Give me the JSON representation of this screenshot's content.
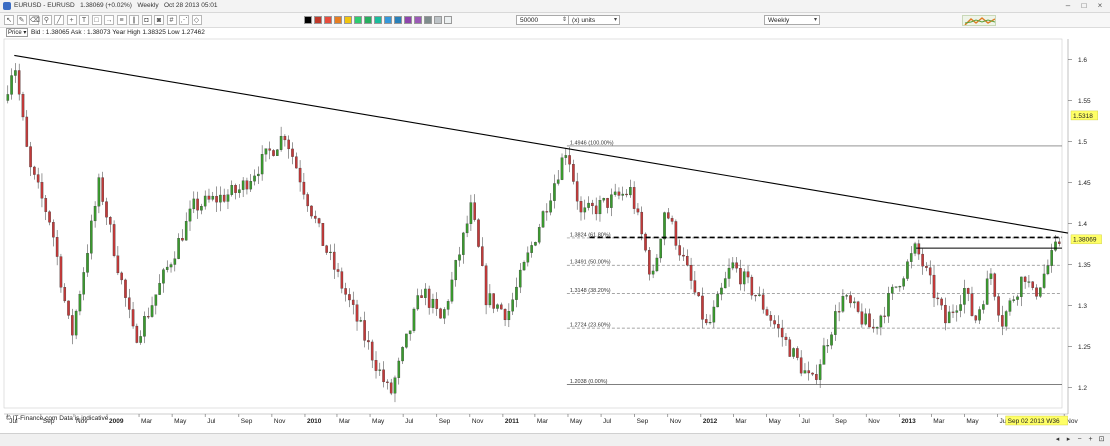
{
  "window": {
    "title": "EURUSD - EURUSD",
    "price_change": "1.38069 (+0.02%)",
    "timeframe": "Weekly",
    "datetime": "Oct 28 2013 05:01"
  },
  "toolbar": {
    "icons": [
      "cursor-icon",
      "pencil-icon",
      "eraser-icon",
      "zoom-icon",
      "line-icon",
      "crosshair-icon",
      "text-icon",
      "shape-icon",
      "arrow-icon",
      "fib-icon",
      "channel-icon",
      "lock-icon",
      "camera-icon",
      "grid-icon",
      "fan-icon",
      "pattern-icon"
    ],
    "swatch_colors": [
      "#000000",
      "#c0392b",
      "#e74c3c",
      "#e67e22",
      "#f1c40f",
      "#2ecc71",
      "#27ae60",
      "#1abc9c",
      "#3498db",
      "#2980b9",
      "#8e44ad",
      "#9b59b6",
      "#7f8c8d",
      "#bdc3c7",
      "#ecf0f1"
    ],
    "quantity_value": "50000",
    "units_value": "(x) units",
    "period_value": "Weekly"
  },
  "info": {
    "price_box": "Price",
    "bid": "Bid : 1.38065",
    "ask": "Ask : 1.38073",
    "year_high": "Year High 1.38325",
    "low": "Low 1.27462"
  },
  "footer": {
    "text": "© IT-Finance.com Data is indicative",
    "tools": [
      "scroll-left-icon",
      "scroll-right-icon",
      "zoom-out-icon",
      "zoom-in-icon",
      "zoom-fit-icon"
    ]
  },
  "chart_data": {
    "type": "candlestick",
    "symbol": "EURUSD",
    "period": "Weekly",
    "y_axis": {
      "min": 1.175,
      "max": 1.625,
      "ticks": [
        1.2,
        1.25,
        1.3,
        1.35,
        1.4,
        1.45,
        1.5,
        1.55,
        1.6
      ],
      "tick_labels": [
        "1.2",
        "1.25",
        "1.3",
        "1.35",
        "1.4",
        "1.45",
        "1.5",
        "1.55",
        "1.6"
      ]
    },
    "x_axis": {
      "start": "2008-06-25",
      "end": "2013-10-28",
      "labels": [
        {
          "date": "2008-07-01",
          "label": "Jul"
        },
        {
          "date": "2008-09-01",
          "label": "Sep"
        },
        {
          "date": "2008-11-01",
          "label": "Nov"
        },
        {
          "date": "2009-01-01",
          "label": "2009"
        },
        {
          "date": "2009-03-01",
          "label": "Mar"
        },
        {
          "date": "2009-05-01",
          "label": "May"
        },
        {
          "date": "2009-07-01",
          "label": "Jul"
        },
        {
          "date": "2009-09-01",
          "label": "Sep"
        },
        {
          "date": "2009-11-01",
          "label": "Nov"
        },
        {
          "date": "2010-01-01",
          "label": "2010"
        },
        {
          "date": "2010-03-01",
          "label": "Mar"
        },
        {
          "date": "2010-05-01",
          "label": "May"
        },
        {
          "date": "2010-07-01",
          "label": "Jul"
        },
        {
          "date": "2010-09-01",
          "label": "Sep"
        },
        {
          "date": "2010-11-01",
          "label": "Nov"
        },
        {
          "date": "2011-01-01",
          "label": "2011"
        },
        {
          "date": "2011-03-01",
          "label": "Mar"
        },
        {
          "date": "2011-05-01",
          "label": "May"
        },
        {
          "date": "2011-07-01",
          "label": "Jul"
        },
        {
          "date": "2011-09-01",
          "label": "Sep"
        },
        {
          "date": "2011-11-01",
          "label": "Nov"
        },
        {
          "date": "2012-01-01",
          "label": "2012"
        },
        {
          "date": "2012-03-01",
          "label": "Mar"
        },
        {
          "date": "2012-05-01",
          "label": "May"
        },
        {
          "date": "2012-07-01",
          "label": "Jul"
        },
        {
          "date": "2012-09-01",
          "label": "Sep"
        },
        {
          "date": "2012-11-01",
          "label": "Nov"
        },
        {
          "date": "2013-01-01",
          "label": "2013"
        },
        {
          "date": "2013-03-01",
          "label": "Mar"
        },
        {
          "date": "2013-05-01",
          "label": "May"
        },
        {
          "date": "2013-07-01",
          "label": "Ju"
        },
        {
          "date": "2013-11-01",
          "label": "Nov"
        }
      ],
      "cursor_label": "Sep 02 2013 W36"
    },
    "price_path": [
      {
        "date": "2008-06-25",
        "price": 1.55
      },
      {
        "date": "2008-07-14",
        "price": 1.6
      },
      {
        "date": "2008-08-10",
        "price": 1.47
      },
      {
        "date": "2008-09-20",
        "price": 1.4
      },
      {
        "date": "2008-10-27",
        "price": 1.26
      },
      {
        "date": "2008-12-18",
        "price": 1.45
      },
      {
        "date": "2009-02-20",
        "price": 1.26
      },
      {
        "date": "2009-03-10",
        "price": 1.28
      },
      {
        "date": "2009-06-10",
        "price": 1.42
      },
      {
        "date": "2009-09-01",
        "price": 1.44
      },
      {
        "date": "2009-11-25",
        "price": 1.51
      },
      {
        "date": "2010-02-01",
        "price": 1.38
      },
      {
        "date": "2010-06-07",
        "price": 1.19
      },
      {
        "date": "2010-08-05",
        "price": 1.32
      },
      {
        "date": "2010-09-10",
        "price": 1.28
      },
      {
        "date": "2010-11-04",
        "price": 1.42
      },
      {
        "date": "2010-12-01",
        "price": 1.31
      },
      {
        "date": "2011-01-10",
        "price": 1.29
      },
      {
        "date": "2011-04-29",
        "price": 1.494
      },
      {
        "date": "2011-05-25",
        "price": 1.41
      },
      {
        "date": "2011-08-25",
        "price": 1.44
      },
      {
        "date": "2011-10-04",
        "price": 1.33
      },
      {
        "date": "2011-10-27",
        "price": 1.42
      },
      {
        "date": "2012-01-13",
        "price": 1.27
      },
      {
        "date": "2012-02-27",
        "price": 1.35
      },
      {
        "date": "2012-04-15",
        "price": 1.31
      },
      {
        "date": "2012-07-24",
        "price": 1.2042
      },
      {
        "date": "2012-09-17",
        "price": 1.31
      },
      {
        "date": "2012-11-13",
        "price": 1.27
      },
      {
        "date": "2013-02-01",
        "price": 1.37
      },
      {
        "date": "2013-03-27",
        "price": 1.28
      },
      {
        "date": "2013-05-01",
        "price": 1.32
      },
      {
        "date": "2013-05-20",
        "price": 1.28
      },
      {
        "date": "2013-06-19",
        "price": 1.34
      },
      {
        "date": "2013-07-09",
        "price": 1.28
      },
      {
        "date": "2013-08-20",
        "price": 1.34
      },
      {
        "date": "2013-09-05",
        "price": 1.31
      },
      {
        "date": "2013-10-25",
        "price": 1.3807
      }
    ],
    "up_color": "#3a9a2e",
    "down_color": "#c23a3a",
    "trendline": {
      "from": {
        "date": "2008-07-14",
        "price": 1.605
      },
      "to": {
        "date": "2013-10-28",
        "price": 1.388
      },
      "color": "#000000"
    },
    "fibonacci": {
      "start_date": "2011-04-29",
      "end_date": "2013-10-28",
      "levels": [
        {
          "price": 1.4946,
          "label": "1.4946 (100.00%)"
        },
        {
          "price": 1.3824,
          "label": "1.3824 (61.80%)"
        },
        {
          "price": 1.3491,
          "label": "1.3491 (50.00%)"
        },
        {
          "price": 1.3148,
          "label": "1.3148 (38.20%)"
        },
        {
          "price": 1.2724,
          "label": "1.2724 (23.60%)"
        },
        {
          "price": 1.2038,
          "label": "1.2038 (0.00%)"
        }
      ]
    },
    "resistance_lines": [
      {
        "price": 1.383,
        "style": "dashed-bold",
        "start_date": "2011-06-10",
        "end_date": "2013-10-28"
      },
      {
        "price": 1.37,
        "style": "solid",
        "start_date": "2013-02-01",
        "end_date": "2013-10-28"
      }
    ],
    "labels": [
      {
        "price": 1.5318,
        "text": "1.5318",
        "background": "#ffff66"
      },
      {
        "price": 1.38069,
        "text": "1.38069",
        "background": "#ffff66"
      }
    ]
  }
}
